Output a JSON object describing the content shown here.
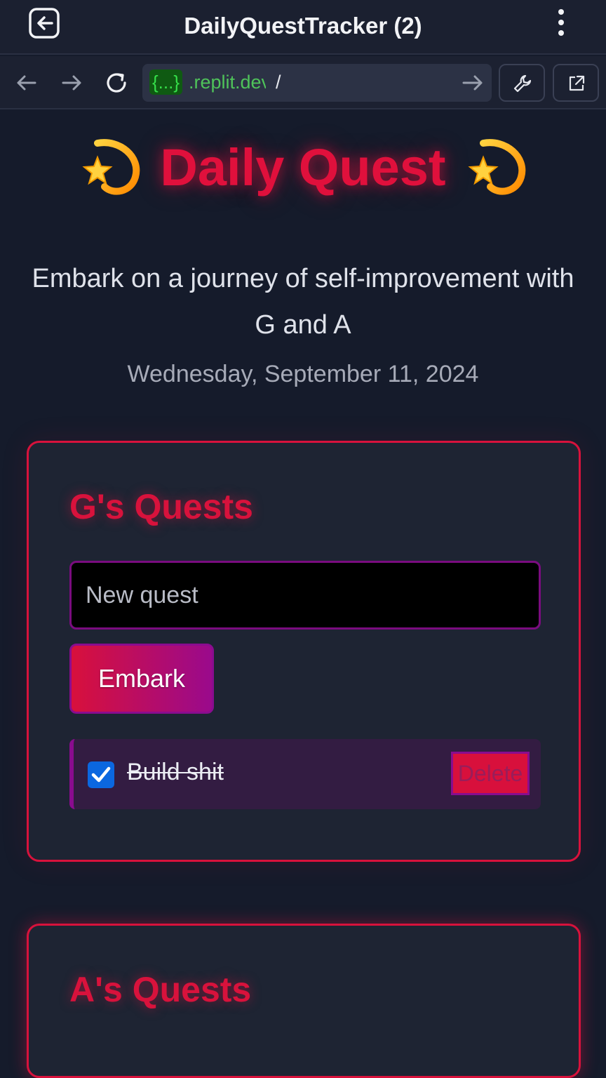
{
  "appbar": {
    "title": "DailyQuestTracker (2)",
    "exit_icon": "exit-app-icon",
    "menu_icon": "kebab-menu-icon"
  },
  "urlbar": {
    "badge": "{...}",
    "host": ".replit.dev",
    "path": "/",
    "icons": [
      "back-arrow-icon",
      "forward-arrow-icon",
      "reload-icon",
      "go-arrow-icon",
      "wrench-icon",
      "open-external-icon"
    ]
  },
  "page": {
    "hero": {
      "emoji": "💫",
      "title": "Daily Quest"
    },
    "subtitle": "Embark on a journey of self-improvement with G and A",
    "date": "Wednesday, September 11, 2024"
  },
  "cards": {
    "g": {
      "title": "G's Quests",
      "input_placeholder": "New quest",
      "input_value": "",
      "embark_label": "Embark",
      "quests": [
        {
          "text": "Build shit",
          "completed": true,
          "delete_label": "Delete"
        }
      ]
    },
    "a": {
      "title": "A's Quests"
    }
  },
  "colors": {
    "accent": "#d8123c",
    "purple": "#8a0c8f",
    "background": "#151b2b",
    "card": "#1e2433",
    "checkbox": "#0b67e0"
  }
}
